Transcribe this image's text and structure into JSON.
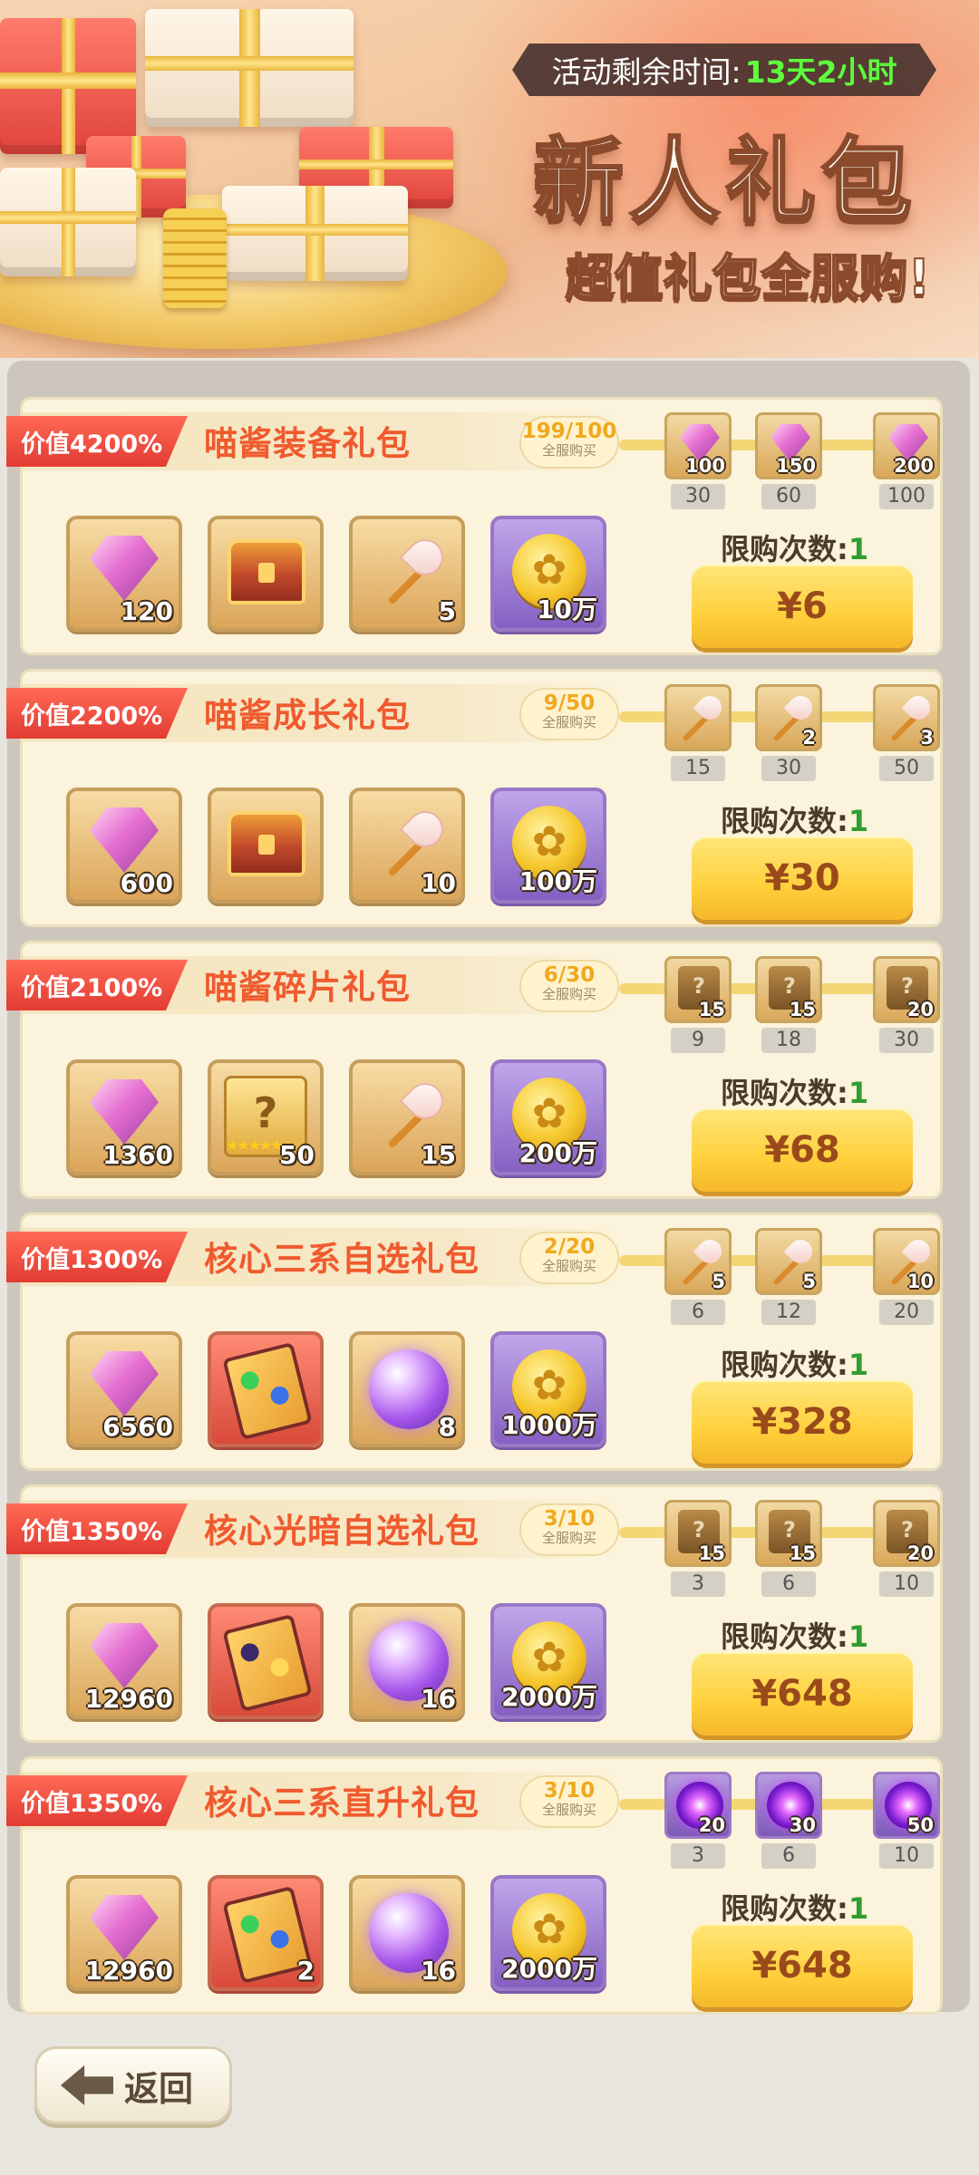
{
  "banner": {
    "timer_label": "活动剩余时间:",
    "timer_value": "13天2小时",
    "title": "新人礼包",
    "subtitle": "超值礼包全服购!"
  },
  "limit_label": "限购次数:",
  "progress_note": "全服购买",
  "packs": [
    {
      "value_tag": "价值4200%",
      "name": "喵酱装备礼包",
      "progress": "199/100",
      "milestones": [
        {
          "icon": "gem-icon",
          "qty": "100",
          "req": "30"
        },
        {
          "icon": "gem-icon",
          "qty": "150",
          "req": "60"
        },
        {
          "icon": "gem-icon",
          "qty": "200",
          "req": "100"
        }
      ],
      "items": [
        {
          "icon": "gem-icon",
          "qty": "120"
        },
        {
          "icon": "treasure-chest-icon",
          "qty": ""
        },
        {
          "icon": "wand-icon",
          "qty": "5"
        },
        {
          "icon": "paw-coin-icon",
          "qty": "10万"
        }
      ],
      "limit": "1",
      "price": "¥6"
    },
    {
      "value_tag": "价值2200%",
      "name": "喵酱成长礼包",
      "progress": "9/50",
      "milestones": [
        {
          "icon": "wand-icon",
          "qty": "",
          "req": "15"
        },
        {
          "icon": "wand-icon",
          "qty": "2",
          "req": "30"
        },
        {
          "icon": "wand-icon",
          "qty": "3",
          "req": "50"
        }
      ],
      "items": [
        {
          "icon": "gem-icon",
          "qty": "600"
        },
        {
          "icon": "treasure-chest-icon",
          "qty": ""
        },
        {
          "icon": "wand-icon",
          "qty": "10"
        },
        {
          "icon": "paw-coin-icon",
          "qty": "100万"
        }
      ],
      "limit": "1",
      "price": "¥30"
    },
    {
      "value_tag": "价值2100%",
      "name": "喵酱碎片礼包",
      "progress": "6/30",
      "milestones": [
        {
          "icon": "mystery-shard-icon",
          "qty": "15",
          "req": "9"
        },
        {
          "icon": "mystery-shard-icon",
          "qty": "15",
          "req": "18"
        },
        {
          "icon": "mystery-shard-icon",
          "qty": "20",
          "req": "30"
        }
      ],
      "items": [
        {
          "icon": "gem-icon",
          "qty": "1360"
        },
        {
          "icon": "mystery-card-icon",
          "qty": "50"
        },
        {
          "icon": "wand-icon",
          "qty": "15"
        },
        {
          "icon": "paw-coin-icon",
          "qty": "200万"
        }
      ],
      "limit": "1",
      "price": "¥68"
    },
    {
      "value_tag": "价值1300%",
      "name": "核心三系自选礼包",
      "progress": "2/20",
      "milestones": [
        {
          "icon": "wand-icon",
          "qty": "5",
          "req": "6"
        },
        {
          "icon": "wand-icon",
          "qty": "5",
          "req": "12"
        },
        {
          "icon": "wand-icon",
          "qty": "10",
          "req": "20"
        }
      ],
      "items": [
        {
          "icon": "gem-icon",
          "qty": "6560"
        },
        {
          "icon": "element-cards-icon",
          "qty": ""
        },
        {
          "icon": "purple-orb-icon",
          "qty": "8"
        },
        {
          "icon": "paw-coin-icon",
          "qty": "1000万"
        }
      ],
      "limit": "1",
      "price": "¥328"
    },
    {
      "value_tag": "价值1350%",
      "name": "核心光暗自选礼包",
      "progress": "3/10",
      "milestones": [
        {
          "icon": "mystery-shard-icon",
          "qty": "15",
          "req": "3"
        },
        {
          "icon": "mystery-shard-icon",
          "qty": "15",
          "req": "6"
        },
        {
          "icon": "mystery-shard-icon",
          "qty": "20",
          "req": "10"
        }
      ],
      "items": [
        {
          "icon": "gem-icon",
          "qty": "12960"
        },
        {
          "icon": "light-dark-cards-icon",
          "qty": ""
        },
        {
          "icon": "purple-orb-icon",
          "qty": "16"
        },
        {
          "icon": "paw-coin-icon",
          "qty": "2000万"
        }
      ],
      "limit": "1",
      "price": "¥648"
    },
    {
      "value_tag": "价值1350%",
      "name": "核心三系直升礼包",
      "progress": "3/10",
      "milestones": [
        {
          "icon": "vortex-icon",
          "qty": "20",
          "req": "3"
        },
        {
          "icon": "vortex-icon",
          "qty": "30",
          "req": "6"
        },
        {
          "icon": "vortex-icon",
          "qty": "50",
          "req": "10"
        }
      ],
      "items": [
        {
          "icon": "gem-icon",
          "qty": "12960"
        },
        {
          "icon": "element-cards-icon",
          "qty": "2"
        },
        {
          "icon": "purple-orb-icon",
          "qty": "16"
        },
        {
          "icon": "paw-coin-icon",
          "qty": "2000万"
        }
      ],
      "limit": "1",
      "price": "¥648"
    }
  ],
  "back_button": {
    "label": "返回"
  }
}
